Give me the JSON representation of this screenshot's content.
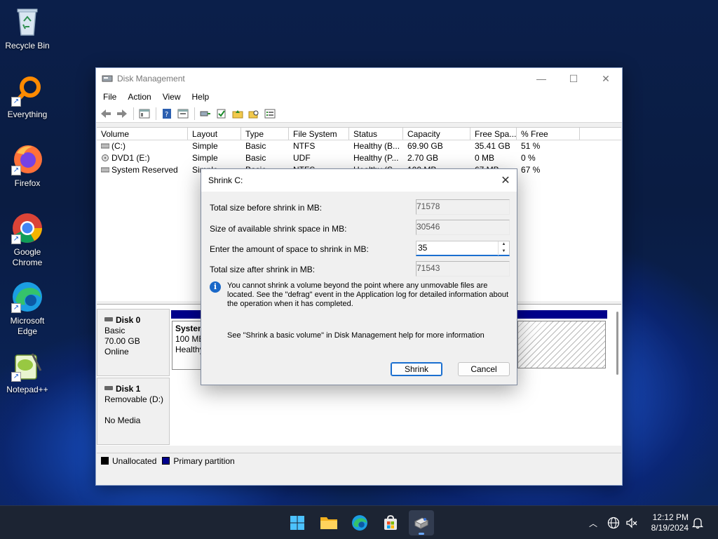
{
  "desktop": {
    "icons": [
      {
        "label": "Recycle Bin",
        "icon": "recycle-bin-icon"
      },
      {
        "label": "Everything",
        "icon": "everything-search-icon"
      },
      {
        "label": "Firefox",
        "icon": "firefox-icon"
      },
      {
        "label": "Google Chrome",
        "icon": "chrome-icon"
      },
      {
        "label": "Microsoft Edge",
        "icon": "edge-icon"
      },
      {
        "label": "Notepad++",
        "icon": "notepad-plus-plus-icon"
      }
    ]
  },
  "window": {
    "title": "Disk Management",
    "menu": [
      "File",
      "Action",
      "View",
      "Help"
    ],
    "columns": [
      "Volume",
      "Layout",
      "Type",
      "File System",
      "Status",
      "Capacity",
      "Free Spa...",
      "% Free"
    ],
    "volumes": [
      {
        "volume": "(C:)",
        "layout": "Simple",
        "type": "Basic",
        "fs": "NTFS",
        "status": "Healthy (B...",
        "capacity": "69.90 GB",
        "free": "35.41 GB",
        "pct": "51 %"
      },
      {
        "volume": "DVD1 (E:)",
        "layout": "Simple",
        "type": "Basic",
        "fs": "UDF",
        "status": "Healthy (P...",
        "capacity": "2.70 GB",
        "free": "0 MB",
        "pct": "0 %"
      },
      {
        "volume": "System Reserved",
        "layout": "Simple",
        "type": "Basic",
        "fs": "NTFS",
        "status": "Healthy (S...",
        "capacity": "100 MB",
        "free": "67 MB",
        "pct": "67 %"
      }
    ],
    "disks": [
      {
        "name": "Disk 0",
        "type": "Basic",
        "size": "70.00 GB",
        "state": "Online"
      },
      {
        "name": "Disk 1",
        "type": "Removable (D:)",
        "size": "",
        "state": "No Media"
      }
    ],
    "disk0_partition": {
      "name": "System",
      "size": "100 MB",
      "status": "Healthy"
    },
    "legend": [
      {
        "label": "Unallocated",
        "color": "#000000"
      },
      {
        "label": "Primary partition",
        "color": "#00008b"
      }
    ]
  },
  "dialog": {
    "title": "Shrink C:",
    "total_before_label": "Total size before shrink in MB:",
    "total_before_value": "71578",
    "available_label": "Size of available shrink space in MB:",
    "available_value": "30546",
    "amount_label": "Enter the amount of space to shrink in MB:",
    "amount_value": "35",
    "total_after_label": "Total size after shrink in MB:",
    "total_after_value": "71543",
    "info_text": "You cannot shrink a volume beyond the point where any unmovable files are located. See the \"defrag\" event in the Application log for detailed information about the operation when it has completed.",
    "help_text": "See \"Shrink a basic volume\" in Disk Management help for more information",
    "shrink_label": "Shrink",
    "cancel_label": "Cancel"
  },
  "taskbar": {
    "time": "12:12 PM",
    "date": "8/19/2024",
    "apps": [
      "start-icon",
      "file-explorer-icon",
      "edge-icon",
      "store-icon",
      "disk-management-icon"
    ]
  }
}
